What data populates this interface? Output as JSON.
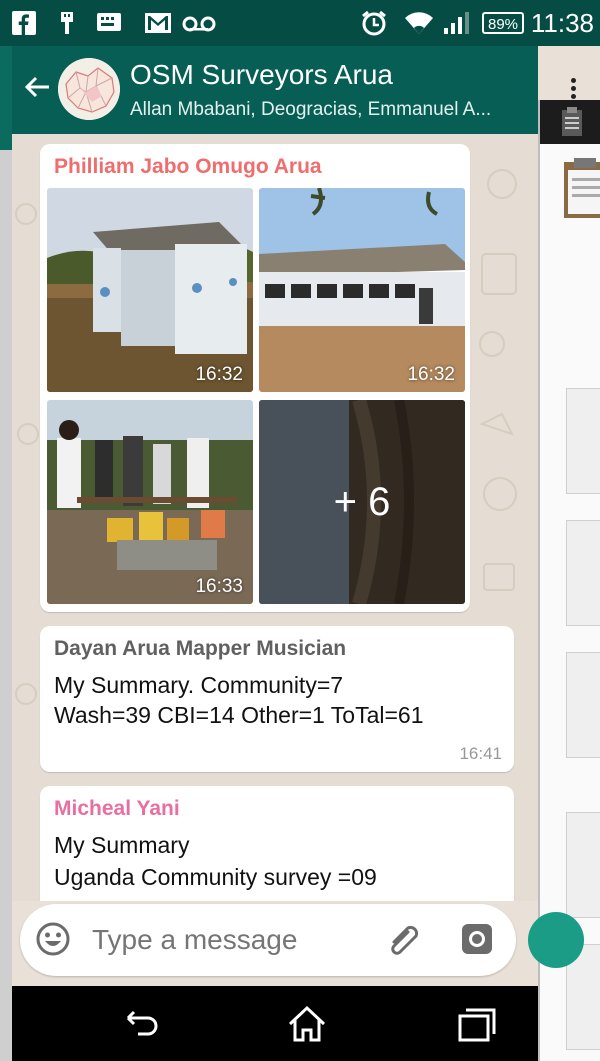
{
  "status_bar": {
    "time": "11:38",
    "battery": "89%",
    "icons": [
      "facebook-icon",
      "usb-icon",
      "keyboard-icon",
      "gmail-icon",
      "voicemail-icon",
      "alarm-icon",
      "wifi-icon",
      "signal-icon"
    ]
  },
  "header": {
    "title": "OSM Surveyors Arua",
    "subtitle": "Allan Mbabani, Deogracias, Emmanuel A..."
  },
  "messages": [
    {
      "sender": "Philliam Jabo Omugo Arua",
      "sender_color": "#f06d6d",
      "photos": [
        {
          "time": "16:32"
        },
        {
          "time": "16:32"
        },
        {
          "time": "16:33"
        },
        {
          "overlay": "+ 6"
        }
      ]
    },
    {
      "sender": "Dayan Arua Mapper Musician",
      "sender_color": "#606060",
      "lines": [
        "My Summary. Community=7",
        "Wash=39 CBI=14 Other=1 ToTal=61"
      ],
      "time": "16:41"
    },
    {
      "sender": "Micheal Yani",
      "sender_color": "#e86fa1",
      "lines": [
        "My Summary",
        "Uganda Community survey =09"
      ]
    }
  ],
  "composer": {
    "placeholder": "Type a message"
  },
  "colors": {
    "status_bar": "#054d44",
    "app_bar": "#075e54",
    "chat_background": "#e5ddd3",
    "accent": "#1a9c86"
  }
}
